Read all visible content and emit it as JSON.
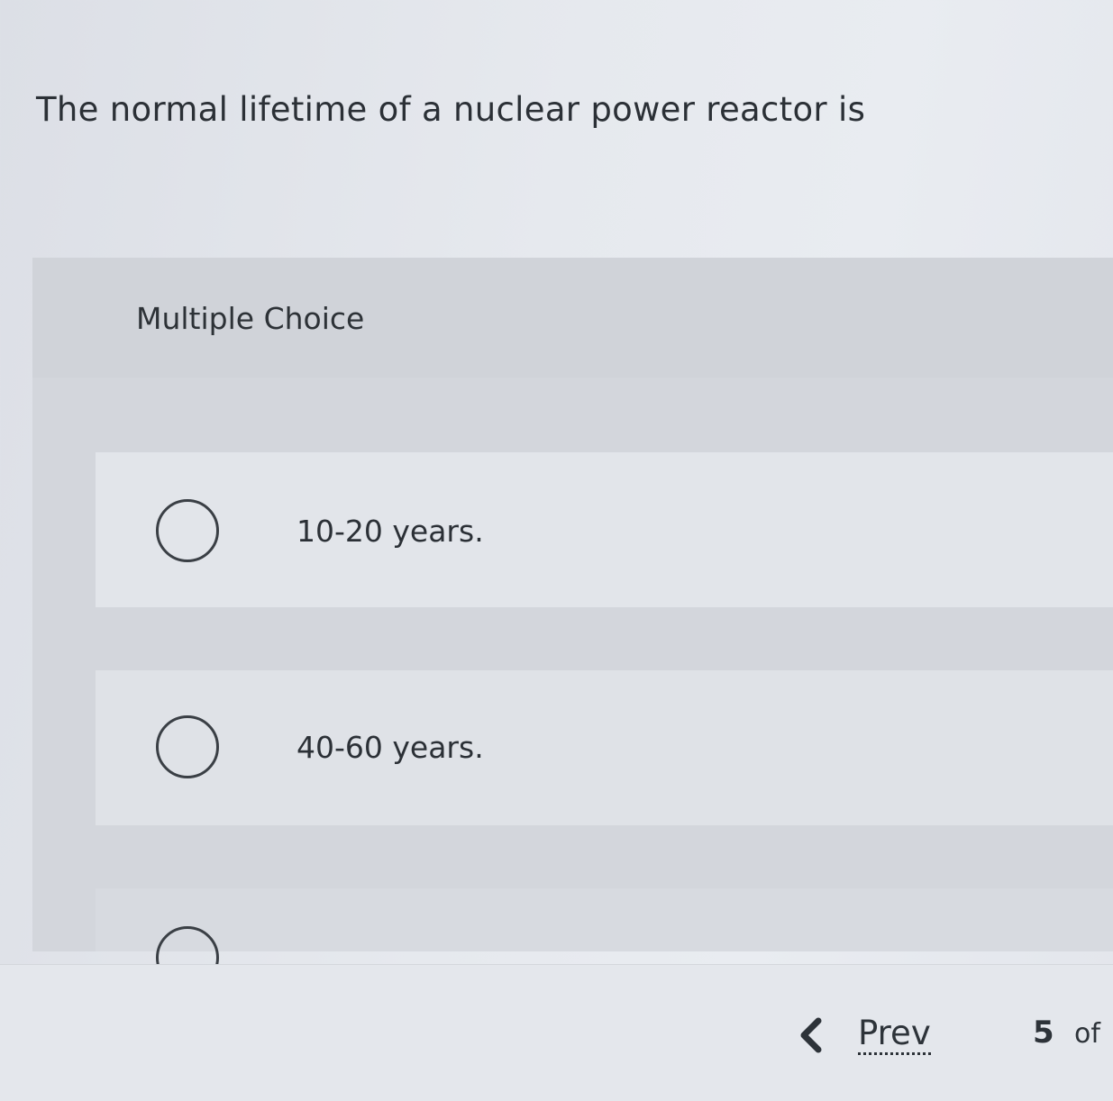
{
  "question": {
    "text": "The normal lifetime of a nuclear power reactor is"
  },
  "mc": {
    "label": "Multiple Choice",
    "options": [
      {
        "text": "10-20 years."
      },
      {
        "text": "40-60 years."
      },
      {
        "text": ""
      }
    ]
  },
  "nav": {
    "prev_label": "Prev",
    "current_page": "5",
    "of_label": "of"
  }
}
